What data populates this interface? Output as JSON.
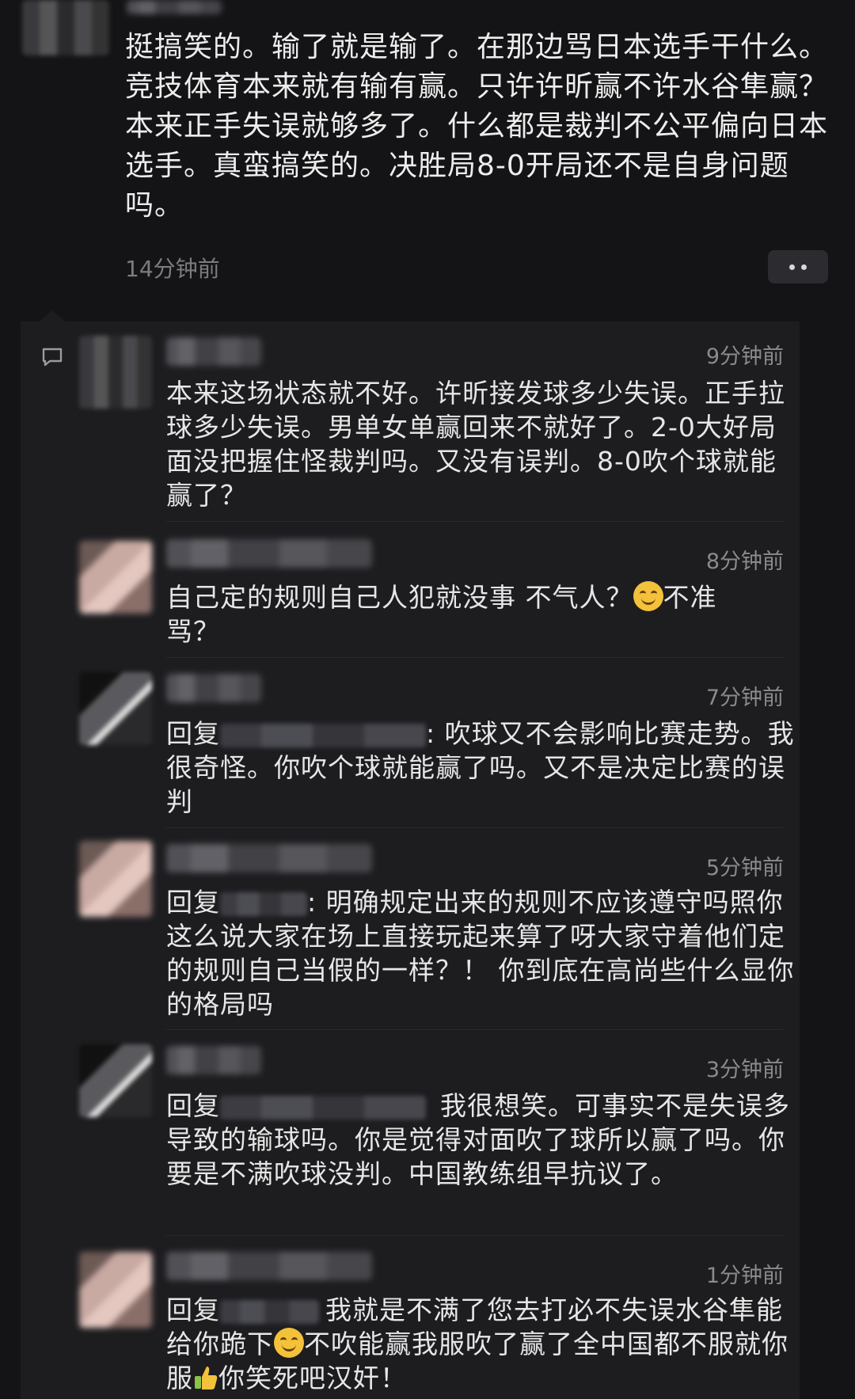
{
  "main_comment": {
    "text": "挺搞笑的。输了就是输了。在那边骂日本选手干什么。竞技体育本来就有输有赢。只许许昕赢不许水谷隼赢？本来正手失误就够多了。什么都是裁判不公平偏向日本选手。真蛮搞笑的。决胜局8-0开局还不是自身问题吗。",
    "time": "14分钟前"
  },
  "icons": {
    "more": "more-dots-icon",
    "comment": "comment-bubble-icon",
    "smile": "smile-emoji-icon",
    "thumb": "thumbs-up-emoji-icon"
  },
  "replies": [
    {
      "time": "9分钟前",
      "text": "本来这场状态就不好。许昕接发球多少失误。正手拉球多少失误。男单女单赢回来不就好了。2-0大好局面没把握住怪裁判吗。又没有误判。8-0吹个球就能赢了？"
    },
    {
      "time": "8分钟前",
      "text_a": "自己定的规则自己人犯就没事 不气人？",
      "text_b": "不准骂？"
    },
    {
      "time": "7分钟前",
      "prefix": "回复",
      "text": ": 吹球又不会影响比赛走势。我很奇怪。你吹个球就能赢了吗。又不是决定比赛的误判"
    },
    {
      "time": "5分钟前",
      "prefix": "回复",
      "text": ": 明确规定出来的规则不应该遵守吗照你这么说大家在场上直接玩起来算了呀大家守着他们定的规则自己当假的一样？！ 你到底在高尚些什么显你的格局吗"
    },
    {
      "time": "3分钟前",
      "prefix": "回复",
      "text": "我很想笑。可事实不是失误多导致的输球吗。你是觉得对面吹了球所以赢了吗。你要是不满吹球没判。中国教练组早抗议了。"
    },
    {
      "time": "1分钟前",
      "prefix": "回复",
      "text_a": "我就是不满了您去打必不失误水谷隼能给你跪下",
      "text_b": "不吹能赢我服吹了赢了全中国都不服就你服",
      "text_c": "你笑死吧汉奸！"
    }
  ]
}
